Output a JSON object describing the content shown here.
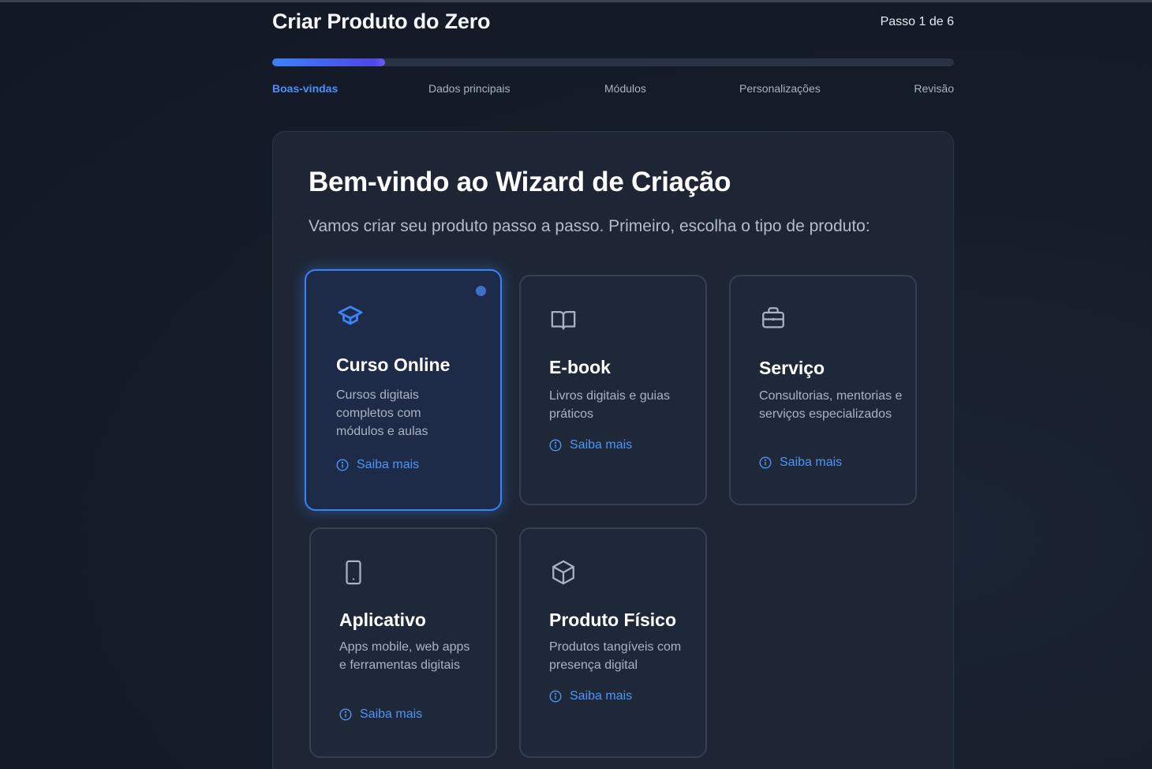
{
  "header": {
    "title": "Criar Produto do Zero",
    "step_count": "Passo 1 de 6",
    "progress": 0.165
  },
  "steps": [
    {
      "label": "Boas-vindas",
      "active": true
    },
    {
      "label": "Dados principais",
      "active": false
    },
    {
      "label": "Módulos",
      "active": false
    },
    {
      "label": "Personalizações",
      "active": false
    },
    {
      "label": "Revisão",
      "active": false
    }
  ],
  "welcome": {
    "title": "Bem-vindo ao Wizard de Criação",
    "subtitle": "Vamos criar seu produto passo a passo. Primeiro, escolha o tipo de produto:"
  },
  "product_types": [
    {
      "name": "Curso Online",
      "description": "Cursos digitais completos com módulos e aulas",
      "more": "Saiba mais",
      "icon": "graduation-cap-icon",
      "selected": true
    },
    {
      "name": "E-book",
      "description": "Livros digitais e guias práticos",
      "more": "Saiba mais",
      "icon": "book-icon",
      "selected": false
    },
    {
      "name": "Serviço",
      "description": "Consultorias, mentorias e serviços especializados",
      "more": "Saiba mais",
      "icon": "briefcase-icon",
      "selected": false
    },
    {
      "name": "Aplicativo",
      "description": "Apps mobile, web apps e ferramentas digitais",
      "more": "Saiba mais",
      "icon": "smartphone-icon",
      "selected": false
    },
    {
      "name": "Produto Físico",
      "description": "Produtos tangíveis com presença digital",
      "more": "Saiba mais",
      "icon": "package-icon",
      "selected": false
    }
  ],
  "colors": {
    "accent": "#3b82f6",
    "link": "#4f95f8",
    "background": "#161d2a",
    "panel": "#1e2635"
  }
}
